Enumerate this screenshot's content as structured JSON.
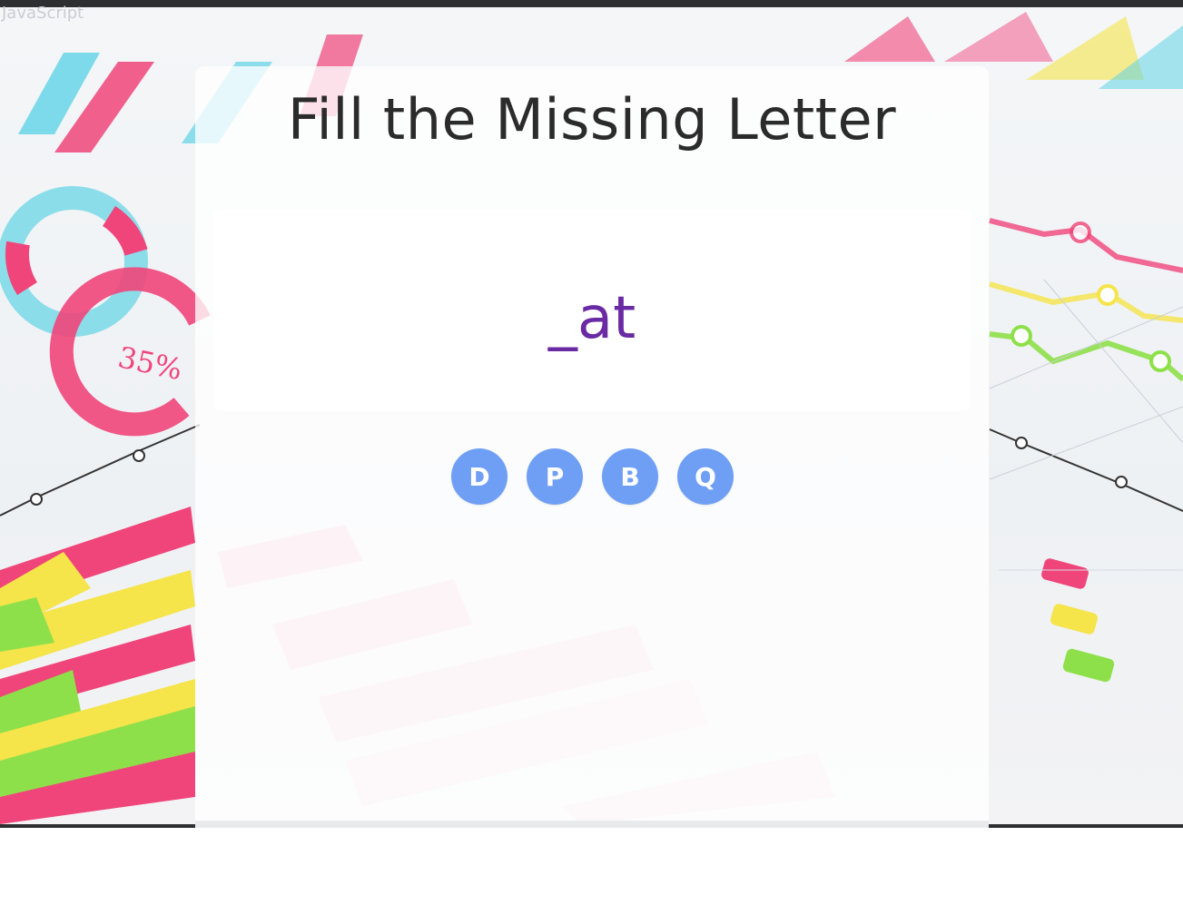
{
  "top_left_text": "JavaScript",
  "game": {
    "title": "Fill the Missing Letter",
    "word": "_at",
    "options": [
      "D",
      "P",
      "B",
      "Q"
    ]
  },
  "background": {
    "decor_label": "35%"
  },
  "colors": {
    "word": "#6a2aa3",
    "option_bg": "#6f9ff5",
    "option_text": "#ffffff",
    "title": "#2b2b2b"
  }
}
